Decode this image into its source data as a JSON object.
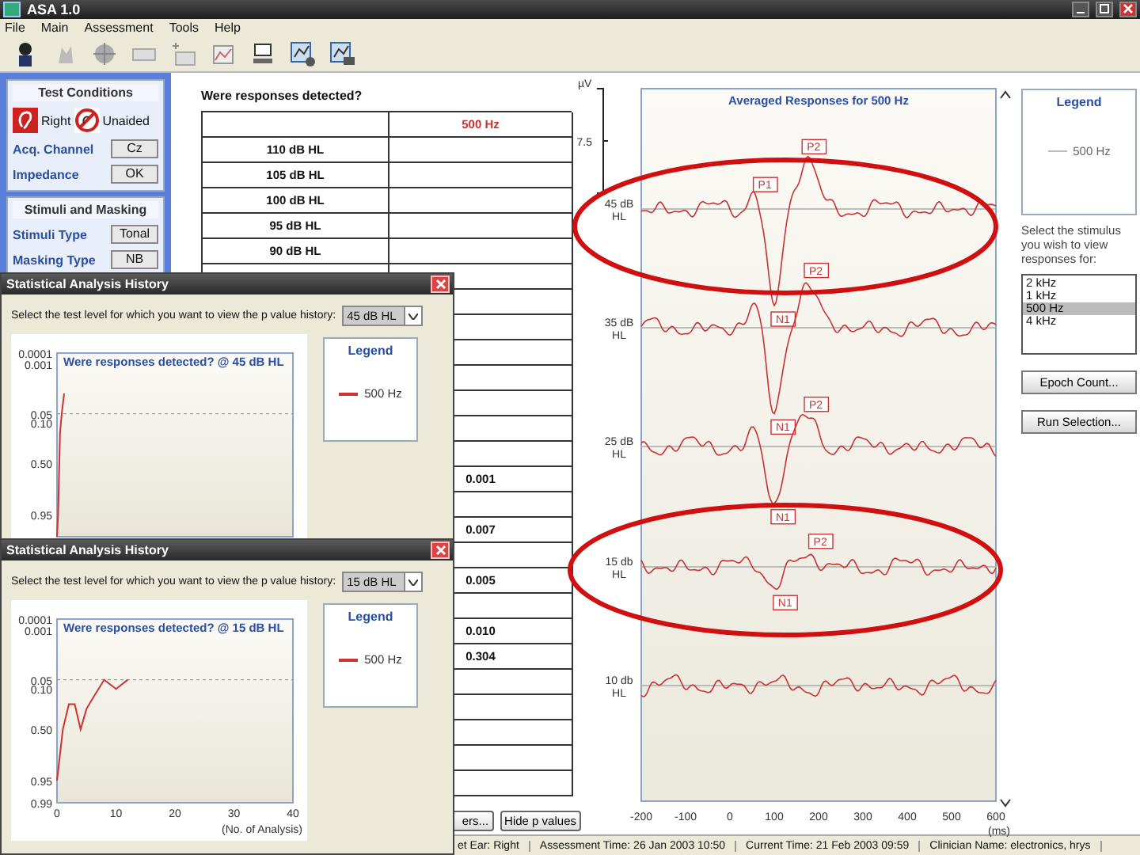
{
  "window": {
    "title": "ASA 1.0"
  },
  "menu": [
    "File",
    "Main",
    "Assessment",
    "Tools",
    "Help"
  ],
  "test_conditions": {
    "title": "Test Conditions",
    "ear": "Right",
    "aid": "Unaided",
    "fields": [
      {
        "label": "Acq. Channel",
        "value": "Cz"
      },
      {
        "label": "Impedance",
        "value": "OK"
      }
    ]
  },
  "stimuli": {
    "title": "Stimuli and Masking",
    "fields": [
      {
        "label": "Stimuli Type",
        "value": "Tonal"
      },
      {
        "label": "Masking Type",
        "value": "NB"
      }
    ]
  },
  "table": {
    "question": "Were responses detected?",
    "columns": [
      "500 Hz"
    ],
    "rows": [
      {
        "label": "110 dB HL"
      },
      {
        "label": "105 dB HL"
      },
      {
        "label": "100 dB HL"
      },
      {
        "label": "95 dB HL"
      },
      {
        "label": "90 dB HL"
      },
      {},
      {},
      {},
      {},
      {},
      {},
      {},
      {},
      {
        "value": "0.001"
      },
      {},
      {
        "value": "0.007"
      },
      {},
      {
        "value": "0.005"
      },
      {},
      {
        "value": "0.010"
      },
      {
        "value": "0.304"
      },
      {},
      {},
      {},
      {},
      {}
    ]
  },
  "table_buttons": [
    "ers...",
    "Hide p values"
  ],
  "responses": {
    "title": "Averaged Responses for 500 Hz",
    "unit": "µV",
    "scale": "7.5",
    "x_ticks": [
      "-200",
      "-100",
      "0",
      "100",
      "200",
      "300",
      "400",
      "500",
      "600"
    ],
    "x_unit": "(ms)",
    "traces": [
      {
        "label": "45 dB HL",
        "peaks": [
          "P1",
          "P2",
          "N1"
        ]
      },
      {
        "label": "35 dB HL",
        "peaks": [
          "P2",
          "N1"
        ]
      },
      {
        "label": "25 dB HL",
        "peaks": [
          "P2",
          "N1"
        ]
      },
      {
        "label": "15 db HL",
        "peaks": [
          "P2",
          "N1"
        ]
      },
      {
        "label": "10 db HL"
      }
    ]
  },
  "legend": {
    "title": "Legend",
    "items": [
      {
        "name": "500 Hz"
      }
    ]
  },
  "stimulus_select": {
    "prompt": "Select the stimulus you wish to view responses for:",
    "options": [
      {
        "label": "2 kHz",
        "selected": false
      },
      {
        "label": "1 kHz",
        "selected": false
      },
      {
        "label": "500 Hz",
        "selected": true
      },
      {
        "label": "4 kHz",
        "selected": false
      }
    ]
  },
  "side_buttons": [
    "Epoch Count...",
    "Run Selection..."
  ],
  "status_bar": [
    "et Ear: Right",
    "Assessment Time: 26 Jan 2003 10:50",
    "Current Time: 21 Feb 2003 09:59",
    "Clinician Name: electronics, hrys"
  ],
  "dialogs": [
    {
      "title": "Statistical Analysis History",
      "prompt": "Select the test level for which you want to view the p value history:",
      "level": "45 dB HL",
      "legend_title": "Legend",
      "chart": {
        "title": "Were responses detected? @ 45 dB HL",
        "y_labels": [
          "0.0001",
          "0.001",
          "0.05",
          "0.10",
          "0.50",
          "0.95"
        ],
        "legend": [
          {
            "name": "500 Hz",
            "color": "#cc3333"
          }
        ]
      }
    },
    {
      "title": "Statistical Analysis History",
      "prompt": "Select the test level for which you want to view the p value history:",
      "level": "15 dB HL",
      "legend_title": "Legend",
      "chart": {
        "title": "Were responses detected? @ 15 dB HL",
        "xlabel": "(No. of Analysis)",
        "y_labels": [
          "0.0001",
          "0.001",
          "0.05",
          "0.10",
          "0.50",
          "0.95",
          "0.99"
        ],
        "x_labels": [
          "0",
          "10",
          "20",
          "30",
          "40"
        ],
        "legend": [
          {
            "name": "500 Hz",
            "color": "#cc3333"
          }
        ]
      }
    }
  ]
}
